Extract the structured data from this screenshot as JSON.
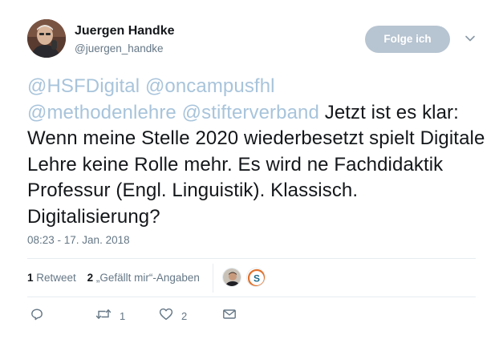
{
  "author": {
    "name": "Juergen Handke",
    "handle": "@juergen_handke",
    "avatar_icon": "user-avatar-photo"
  },
  "follow_button": {
    "label": "Folge ich"
  },
  "menu_icon": "chevron-down-icon",
  "tweet": {
    "mentions": [
      "@HSFDigital",
      "@oncampusfhl",
      "@methodenlehre",
      "@stifterverband"
    ],
    "body": "Jetzt ist es klar: Wenn meine Stelle 2020 wiederbesetzt spielt Digitale Lehre keine Rolle mehr. Es wird ne Fachdidaktik Professur (Engl. Linguistik). Klassisch. Digitalisierung?",
    "mention_color": "#a8c4db"
  },
  "timestamp": "08:23 - 17. Jan. 2018",
  "stats": {
    "retweets_count": "1",
    "retweets_label": "Retweet",
    "likes_count": "2",
    "likes_label": "„Gefällt mir“-Angaben"
  },
  "likers": [
    {
      "icon": "user-avatar-photo"
    },
    {
      "icon": "letter-s-avatar",
      "letter": "S"
    }
  ],
  "actions": {
    "reply": {
      "icon": "reply-icon"
    },
    "retweet": {
      "icon": "retweet-icon",
      "count": "1"
    },
    "like": {
      "icon": "heart-icon",
      "count": "2"
    },
    "dm": {
      "icon": "envelope-icon"
    }
  },
  "colors": {
    "follow_button_bg": "#b7c4d1",
    "secondary_text": "#657786",
    "divider": "#e6ecf0"
  }
}
